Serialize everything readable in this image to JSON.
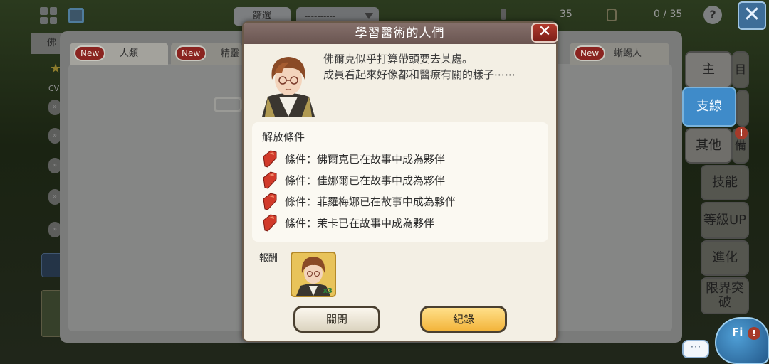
{
  "topbar": {
    "filter_label": "篩選",
    "sort_value": "----------",
    "count_a": "35",
    "count_b": "0 / 35",
    "help_label": "?",
    "close_glyph": "✕"
  },
  "left_strip": {
    "tag": "佛",
    "cv": "CV"
  },
  "category_tabs": [
    {
      "badge": "New",
      "label": "人類"
    },
    {
      "badge": "New",
      "label": "精靈"
    },
    {
      "badge": "New",
      "label": "蜥蜴人"
    }
  ],
  "side_menu": {
    "main": "主",
    "main_right": "目",
    "branch": "支線",
    "other": "其他",
    "other_right": "備",
    "skill": "技能",
    "level_up": "等級UP",
    "evolve": "進化",
    "limit_break": "限界突破",
    "alert_glyph": "!"
  },
  "mascot": {
    "label": "Fi",
    "alert_glyph": "!",
    "chat_glyph": "···"
  },
  "dialog": {
    "title": "學習醫術的人們",
    "close_glyph": "✕",
    "story_line1": "佛爾克似乎打算帶頭要去某處。",
    "story_line2": "成員看起來好像都和醫療有關的樣子⋯⋯",
    "conditions_title": "解放條件",
    "conditions": [
      "條件：佛爾克已在故事中成為夥伴",
      "條件：佳娜爾已在故事中成為夥伴",
      "條件：菲羅梅娜已在故事中成為夥伴",
      "條件：茉卡已在故事中成為夥伴"
    ],
    "reward_label": "報酬",
    "reward_qty": "x3",
    "btn_close": "關閉",
    "btn_record": "紀錄"
  },
  "colors": {
    "title_bar": "#7a6460",
    "branch_button": "#3f8bc9",
    "record_button": "#f3b53c",
    "new_badge": "#8a2420"
  }
}
